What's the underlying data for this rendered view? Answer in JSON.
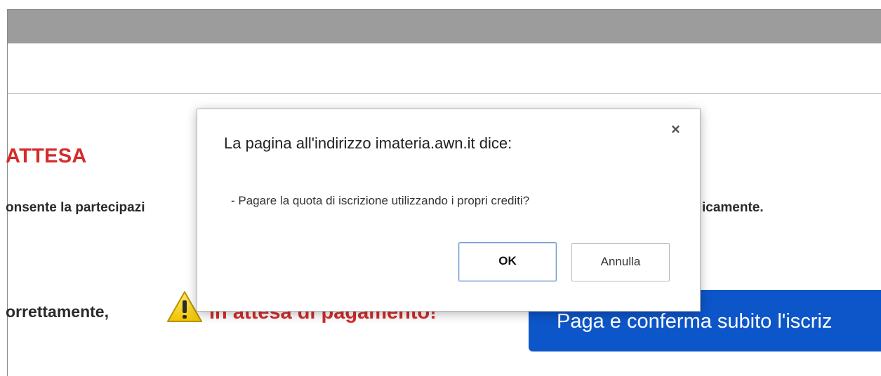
{
  "page": {
    "status_title": "ATTESA",
    "line_left": "onsente la partecipazi",
    "line_right": "icamente.",
    "status_prefix": "orrettamente,",
    "payment_status": "In attesa di pagamento!",
    "pay_button_label": "Paga e conferma subito l'iscriz",
    "warning_icon": "warning-icon"
  },
  "dialog": {
    "title": "La pagina all'indirizzo imateria.awn.it dice:",
    "close_glyph": "×",
    "message": "- Pagare la quota di iscrizione utilizzando i propri crediti?",
    "ok_label": "OK",
    "cancel_label": "Annulla"
  },
  "colors": {
    "accent_red": "#d42b2b",
    "button_blue": "#0d56c9",
    "top_bar_gray": "#9c9c9c",
    "warning_yellow": "#f5d300"
  }
}
